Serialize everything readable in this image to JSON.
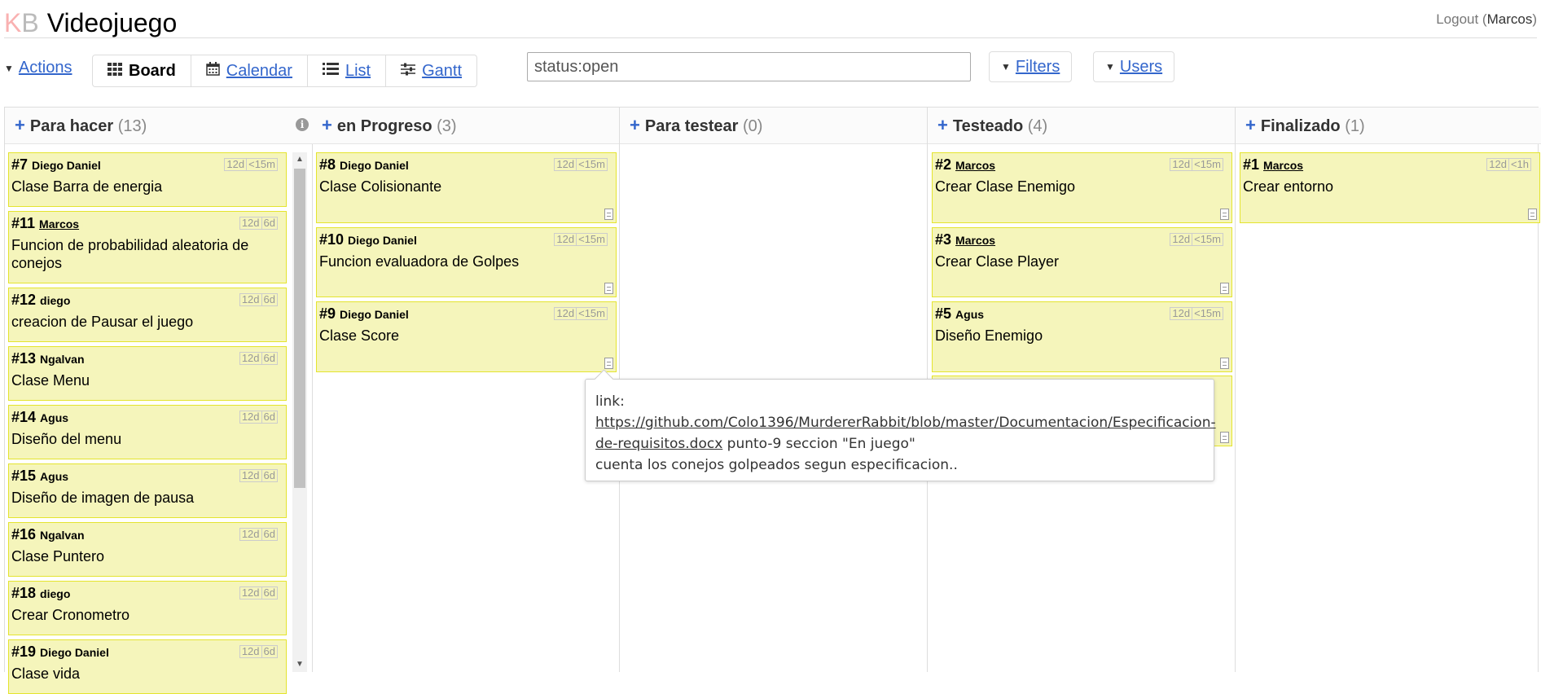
{
  "header": {
    "logo_k": "K",
    "logo_b": "B",
    "project": "Videojuego",
    "logout": "Logout",
    "user": "Marcos"
  },
  "toolbar": {
    "actions": "Actions",
    "views": {
      "board": "Board",
      "calendar": "Calendar",
      "list": "List",
      "gantt": "Gantt"
    },
    "search_value": "status:open",
    "filters": "Filters",
    "users": "Users"
  },
  "columns": [
    {
      "name": "Para hacer",
      "count": "(13)",
      "cards": [
        {
          "id": "#7",
          "owner": "Diego Daniel",
          "title": "Clase Barra de energia",
          "age": [
            "12d",
            "<15m"
          ]
        },
        {
          "id": "#11",
          "owner": "Marcos",
          "title": "Funcion de probabilidad aleatoria de conejos",
          "age": [
            "12d",
            "6d"
          ]
        },
        {
          "id": "#12",
          "owner": "diego",
          "title": "creacion de Pausar el juego",
          "age": [
            "12d",
            "6d"
          ]
        },
        {
          "id": "#13",
          "owner": "Ngalvan",
          "title": "Clase Menu",
          "age": [
            "12d",
            "6d"
          ]
        },
        {
          "id": "#14",
          "owner": "Agus",
          "title": "Diseño del menu",
          "age": [
            "12d",
            "6d"
          ]
        },
        {
          "id": "#15",
          "owner": "Agus",
          "title": "Diseño de imagen de pausa",
          "age": [
            "12d",
            "6d"
          ]
        },
        {
          "id": "#16",
          "owner": "Ngalvan",
          "title": "Clase Puntero",
          "age": [
            "12d",
            "6d"
          ]
        },
        {
          "id": "#18",
          "owner": "diego",
          "title": "Crear Cronometro",
          "age": [
            "12d",
            "6d"
          ]
        },
        {
          "id": "#19",
          "owner": "Diego Daniel",
          "title": "Clase vida",
          "age": [
            "12d",
            "6d"
          ]
        }
      ]
    },
    {
      "name": "en Progreso",
      "count": "(3)",
      "cards": [
        {
          "id": "#8",
          "owner": "Diego Daniel",
          "title": "Clase Colisionante",
          "age": [
            "12d",
            "<15m"
          ]
        },
        {
          "id": "#10",
          "owner": "Diego Daniel",
          "title": "Funcion evaluadora de Golpes",
          "age": [
            "12d",
            "<15m"
          ]
        },
        {
          "id": "#9",
          "owner": "Diego Daniel",
          "title": "Clase Score",
          "age": [
            "12d",
            "<15m"
          ]
        }
      ]
    },
    {
      "name": "Para testear",
      "count": "(0)",
      "cards": []
    },
    {
      "name": "Testeado",
      "count": "(4)",
      "cards": [
        {
          "id": "#2",
          "owner": "Marcos",
          "title": "Crear Clase Enemigo",
          "age": [
            "12d",
            "<15m"
          ]
        },
        {
          "id": "#3",
          "owner": "Marcos",
          "title": "Crear Clase Player",
          "age": [
            "12d",
            "<15m"
          ]
        },
        {
          "id": "#5",
          "owner": "Agus",
          "title": "Diseño Enemigo",
          "age": [
            "12d",
            "<15m"
          ]
        }
      ]
    },
    {
      "name": "Finalizado",
      "count": "(1)",
      "cards": [
        {
          "id": "#1",
          "owner": "Marcos",
          "title": "Crear entorno",
          "age": [
            "12d",
            "<1h"
          ]
        }
      ]
    }
  ],
  "tooltip": {
    "line1": "link:",
    "url": "https://github.com/Colo1396/MurdererRabbit/blob/master/Documentacion/Especificacion-de-requisitos.docx",
    "after_url": " punto-9 seccion \"En juego\"",
    "line3": "cuenta los conejos golpeados segun especificacion.."
  }
}
